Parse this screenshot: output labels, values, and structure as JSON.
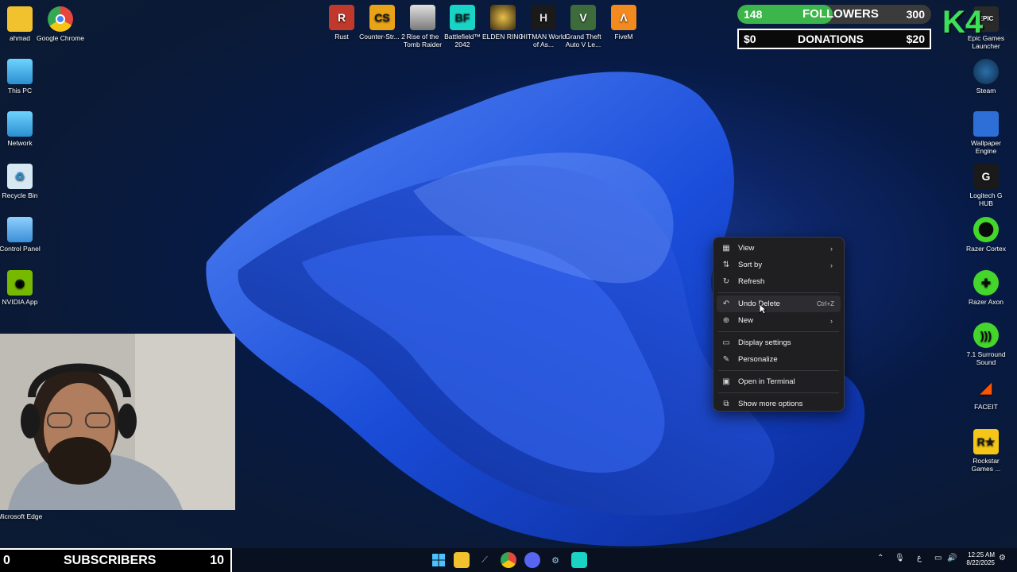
{
  "desktop": {
    "left_icons": [
      {
        "label": "ahmad",
        "icon": "folder-icon",
        "color": "#f2c12e"
      },
      {
        "label": "Google Chrome",
        "icon": "chrome-icon",
        "color": "#e8453c"
      },
      {
        "label": "This PC",
        "icon": "monitor-icon",
        "color": "#3aa7e0"
      },
      {
        "label": "Network",
        "icon": "network-icon",
        "color": "#3aa7e0"
      },
      {
        "label": "Recycle Bin",
        "icon": "recycle-bin-icon",
        "color": "#d7e8f2"
      },
      {
        "label": "Control Panel",
        "icon": "control-panel-icon",
        "color": "#5bb3e6"
      },
      {
        "label": "NVIDIA App",
        "icon": "nvidia-icon",
        "color": "#76b900"
      },
      {
        "label": "Microsoft Edge",
        "icon": "edge-icon",
        "color": "#1f8ad6"
      }
    ],
    "top_icons": [
      {
        "label": "Rust",
        "icon": "rust-icon",
        "color": "#c0392b"
      },
      {
        "label": "Counter-Str... 2",
        "icon": "counter-strike-icon",
        "color": "#e8a317"
      },
      {
        "label": "Rise of the Tomb Raider",
        "icon": "tomb-raider-icon",
        "color": "#cfcfcf"
      },
      {
        "label": "Battlefield™ 2042",
        "icon": "battlefield-icon",
        "color": "#19d3c5"
      },
      {
        "label": "ELDEN RING",
        "icon": "elden-ring-icon",
        "color": "#6b5a2a"
      },
      {
        "label": "HITMAN World of As...",
        "icon": "hitman-icon",
        "color": "#1a1a1a"
      },
      {
        "label": "Grand Theft Auto V Le...",
        "icon": "gta-icon",
        "color": "#3d6b3a"
      },
      {
        "label": "FiveM",
        "icon": "fivem-icon",
        "color": "#f28a1f"
      }
    ],
    "right_icons": [
      {
        "label": "Epic Games Launcher",
        "icon": "epic-games-icon",
        "color": "#2a2a2a"
      },
      {
        "label": "Steam",
        "icon": "steam-icon",
        "color": "#1b4d7a"
      },
      {
        "label": "Wallpaper Engine",
        "icon": "wallpaper-engine-icon",
        "color": "#2d6fd6"
      },
      {
        "label": "Logitech G HUB",
        "icon": "logitech-icon",
        "color": "#1a1a1a"
      },
      {
        "label": "Razer Cortex",
        "icon": "razer-cortex-icon",
        "color": "#44d62c"
      },
      {
        "label": "Razer Axon",
        "icon": "razer-axon-icon",
        "color": "#44d62c"
      },
      {
        "label": "7.1 Surround Sound",
        "icon": "surround-sound-icon",
        "color": "#44d62c"
      },
      {
        "label": "FACEIT",
        "icon": "faceit-icon",
        "color": "#ff5500"
      },
      {
        "label": "Rockstar Games ...",
        "icon": "rockstar-icon",
        "color": "#f5c518"
      }
    ]
  },
  "overlay": {
    "followers": {
      "current": "148",
      "label": "FOLLOWERS",
      "goal": "300",
      "progress": 0.49
    },
    "donations": {
      "current": "$0",
      "label": "DONATIONS",
      "goal": "$20"
    },
    "subscribers": {
      "current": "0",
      "label": "SUBSCRIBERS",
      "goal": "10"
    },
    "logo_text": "K4"
  },
  "context_menu": {
    "items": [
      {
        "label": "View",
        "icon": "grid-icon",
        "submenu": true
      },
      {
        "label": "Sort by",
        "icon": "sort-icon",
        "submenu": true
      },
      {
        "label": "Refresh",
        "icon": "refresh-icon"
      },
      {
        "label": "Undo Delete",
        "icon": "undo-icon",
        "shortcut": "Ctrl+Z"
      },
      {
        "label": "New",
        "icon": "plus-circle-icon",
        "submenu": true
      },
      {
        "label": "Display settings",
        "icon": "display-icon"
      },
      {
        "label": "Personalize",
        "icon": "pen-icon"
      },
      {
        "label": "Open in Terminal",
        "icon": "terminal-icon"
      },
      {
        "label": "Show more options",
        "icon": "more-options-icon"
      }
    ]
  },
  "taskbar": {
    "apps": [
      "windows-start-icon",
      "file-explorer-icon",
      "vscode-icon",
      "chrome-icon",
      "discord-icon",
      "steam-icon",
      "app-icon"
    ],
    "tray_text": "ع",
    "time": "12:25 AM",
    "date": "8/22/2025"
  }
}
